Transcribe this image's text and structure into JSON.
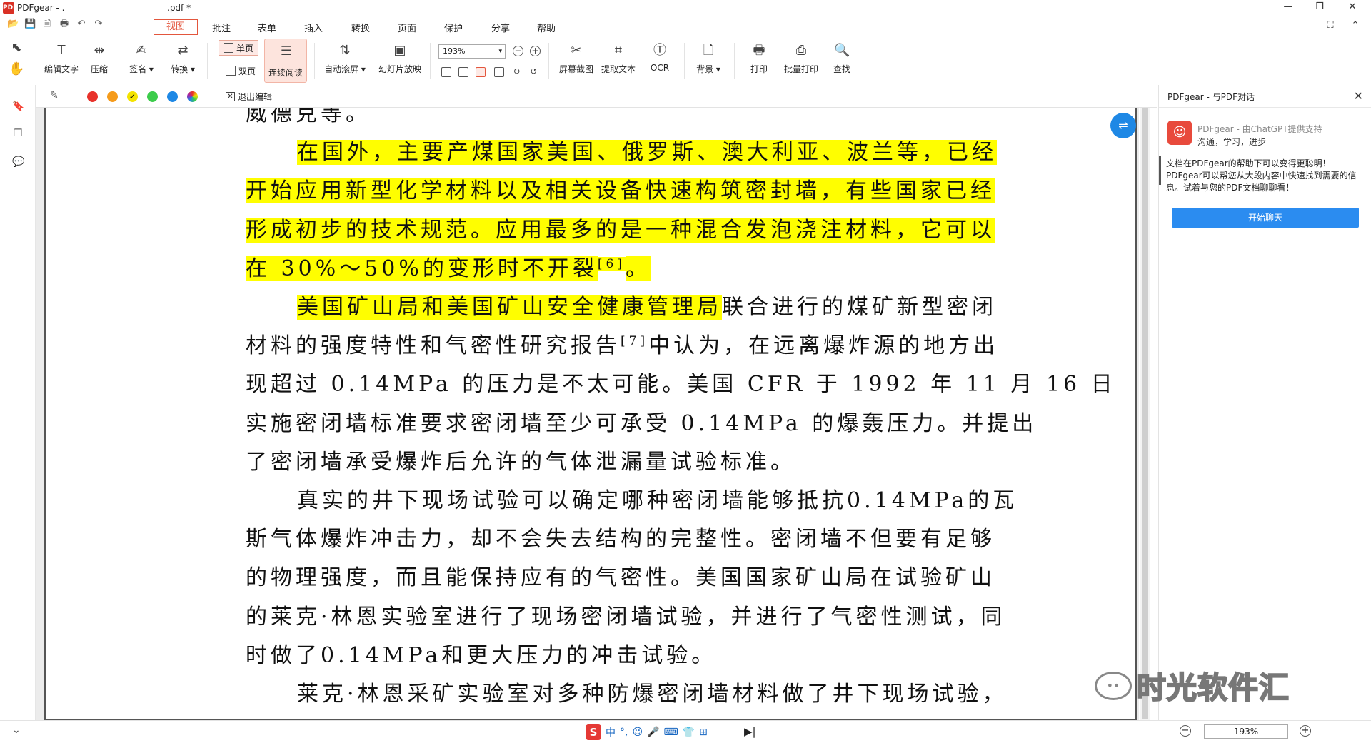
{
  "titlebar": {
    "app_name": "PDFgear - .",
    "file_name": ".pdf *",
    "logo_text": "PDF"
  },
  "menu": {
    "tabs": [
      "视图",
      "批注",
      "表单",
      "插入",
      "转换",
      "页面",
      "保护",
      "分享",
      "帮助"
    ],
    "active_tab": "视图"
  },
  "window_controls": {
    "minimize": "—",
    "restore": "❐",
    "close": "✕"
  },
  "ribbon": {
    "edit_text": "编辑文字",
    "compress": "压缩",
    "sign": "签名 ▾",
    "convert": "转换 ▾",
    "single_page": "单页",
    "double_page": "双页",
    "continuous": "连续阅读",
    "auto_scroll": "自动滚屏 ▾",
    "slideshow": "幻灯片放映",
    "zoom_value": "193%",
    "screenshot": "屏幕截图",
    "extract_text": "提取文本",
    "ocr": "OCR",
    "background": "背景 ▾",
    "print": "打印",
    "batch_print": "批量打印",
    "find": "查找"
  },
  "annotation_bar": {
    "colors": [
      "#e8322b",
      "#f59b1b",
      "#f4e300",
      "#3ccc4b",
      "#1e88e5",
      "multicolor"
    ],
    "selected_color": "#f4e300",
    "exit_edit": "退出编辑"
  },
  "document": {
    "lines": [
      {
        "segments": [
          {
            "text": "威德克等。",
            "hl": false
          }
        ],
        "indent": false
      },
      {
        "segments": [
          {
            "text": "在国外，主要产煤国家美国、俄罗斯、澳大利亚、波兰等，已经",
            "hl": true
          }
        ],
        "indent": true
      },
      {
        "segments": [
          {
            "text": "开始应用新型化学材料以及相关设备快速构筑密封墙，有些国家已经",
            "hl": true
          }
        ],
        "indent": false
      },
      {
        "segments": [
          {
            "text": "形成初步的技术规范。应用最多的是一种混合发泡浇注材料，它可以",
            "hl": true
          }
        ],
        "indent": false
      },
      {
        "segments": [
          {
            "text": "在 30%～50%的变形时不开裂",
            "hl": true
          },
          {
            "text": "[6]",
            "hl": true,
            "sup": true
          },
          {
            "text": "。",
            "hl": true
          }
        ],
        "indent": false
      },
      {
        "segments": [
          {
            "text": "美国矿山局和美国矿山安全健康管理局",
            "hl": true
          },
          {
            "text": "联合进行的煤矿新型密闭",
            "hl": false
          }
        ],
        "indent": true
      },
      {
        "segments": [
          {
            "text": "材料的强度特性和气密性研究报告",
            "hl": false
          },
          {
            "text": "[7]",
            "hl": false,
            "sup": true
          },
          {
            "text": "中认为，在远离爆炸源的地方出",
            "hl": false
          }
        ],
        "indent": false
      },
      {
        "segments": [
          {
            "text": "现超过 0.14MPa 的压力是不太可能。美国 CFR 于 1992 年 11 月 16 日",
            "hl": false
          }
        ],
        "indent": false
      },
      {
        "segments": [
          {
            "text": "实施密闭墙标准要求密闭墙至少可承受 0.14MPa 的爆轰压力。并提出",
            "hl": false
          }
        ],
        "indent": false
      },
      {
        "segments": [
          {
            "text": "了密闭墙承受爆炸后允许的气体泄漏量试验标准。",
            "hl": false
          }
        ],
        "indent": false
      },
      {
        "segments": [
          {
            "text": "真实的井下现场试验可以确定哪种密闭墙能够抵抗0.14MPa的瓦",
            "hl": false
          }
        ],
        "indent": true
      },
      {
        "segments": [
          {
            "text": "斯气体爆炸冲击力，却不会失去结构的完整性。密闭墙不但要有足够",
            "hl": false
          }
        ],
        "indent": false
      },
      {
        "segments": [
          {
            "text": "的物理强度，而且能保持应有的气密性。美国国家矿山局在试验矿山",
            "hl": false
          }
        ],
        "indent": false
      },
      {
        "segments": [
          {
            "text": "的莱克·林恩实验室进行了现场密闭墙试验，并进行了气密性测试，同",
            "hl": false
          }
        ],
        "indent": false
      },
      {
        "segments": [
          {
            "text": "时做了0.14MPa和更大压力的冲击试验。",
            "hl": false
          }
        ],
        "indent": false
      },
      {
        "segments": [
          {
            "text": "莱克·林恩采矿实验室对多种防爆密闭墙材料做了井下现场试验，",
            "hl": false
          }
        ],
        "indent": true
      }
    ]
  },
  "chat_panel": {
    "title": "PDFgear - 与PDF对话",
    "bot_name": "PDFgear - 由ChatGPT提供支持",
    "bot_tagline": "沟通，学习，进步",
    "intro": "文档在PDFgear的帮助下可以变得更聪明！PDFgear可以帮您从大段内容中快速找到需要的信息。试着与您的PDF文档聊聊看！",
    "start_button": "开始聊天"
  },
  "watermark": {
    "text": "时光软件汇"
  },
  "statusbar": {
    "ime_logo": "S",
    "ime_items": [
      "中",
      "°,",
      "☺",
      "🎤",
      "⌨",
      "👕",
      "⊞"
    ],
    "zoom_value": "193%",
    "zoom_out": "−",
    "zoom_in": "+"
  }
}
